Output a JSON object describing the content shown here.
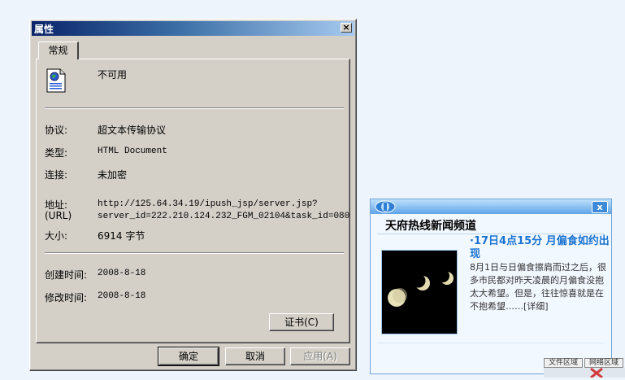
{
  "dialog": {
    "title": "属性",
    "close_glyph": "×",
    "tab_general": "常规",
    "name_value": "不可用",
    "protocol_label": "协议:",
    "protocol_value": "超文本传输协议",
    "type_label": "类型:",
    "type_value": "HTML Document",
    "connection_label": "连接:",
    "connection_value": "未加密",
    "address_label": "地址:",
    "address_label_sub": "(URL)",
    "address_line1": "http://125.64.34.19/ipush_jsp/server.jsp?",
    "address_line2": "server_id=222.210.124.232_FGM_02104&task_id=080",
    "size_label": "大小:",
    "size_value": "6914 字节",
    "created_label": "创建时间:",
    "created_value": "2008-8-18",
    "modified_label": "修改时间:",
    "modified_value": "2008-8-18",
    "certificate_button": "证书(C)",
    "ok_button": "确定",
    "cancel_button": "取消",
    "apply_button": "应用(A)"
  },
  "news_popup": {
    "close_glyph": "x",
    "channel_title": "天府热线新闻频道",
    "headline": "·17日4点15分 月偏食如约出现",
    "body": "8月1日与日偏食擦肩而过之后，很多市民都对昨天凌晨的月偏食没抱太大希望。但是，往往惊喜就是在不抱希望……[详细]"
  },
  "region_tabs": {
    "file_region": "文件区域",
    "network_region": "网络区域"
  },
  "colors": {
    "dialog_face": "#d4d0c8",
    "title_bar_start": "#0a246a",
    "title_bar_end": "#a6caf0",
    "news_headline": "#1a73d0",
    "desktop_bg": "#eef4fb"
  }
}
